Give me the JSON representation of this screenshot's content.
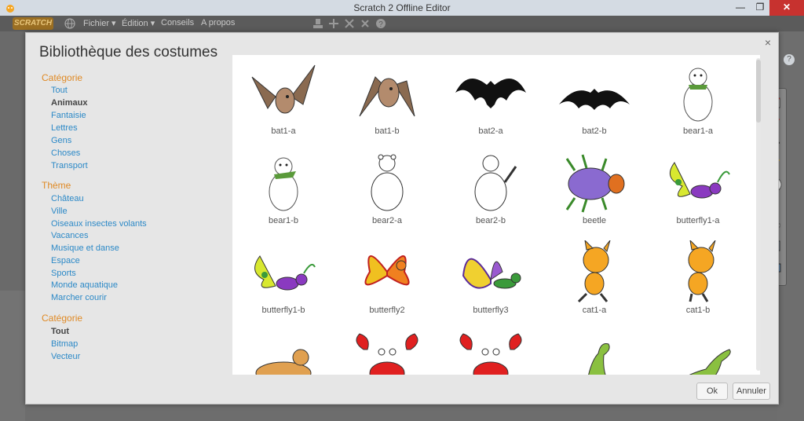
{
  "window": {
    "title": "Scratch 2 Offline Editor"
  },
  "menubar": {
    "logo": "SCRATCH",
    "items": [
      "Fichier ▾",
      "Édition ▾",
      "Conseils",
      "A propos"
    ]
  },
  "dialog": {
    "title": "Bibliothèque des costumes",
    "close": "×",
    "sidebar": {
      "category_heading": "Catégorie",
      "categories": [
        "Tout",
        "Animaux",
        "Fantaisie",
        "Lettres",
        "Gens",
        "Choses",
        "Transport"
      ],
      "selected_category": "Animaux",
      "theme_heading": "Thème",
      "themes": [
        "Château",
        "Ville",
        "Oiseaux insectes volants",
        "Vacances",
        "Musique et danse",
        "Espace",
        "Sports",
        "Monde aquatique",
        "Marcher courir"
      ],
      "type_heading": "Catégorie",
      "types": [
        "Tout",
        "Bitmap",
        "Vecteur"
      ],
      "selected_type": "Tout"
    },
    "costumes": [
      "bat1-a",
      "bat1-b",
      "bat2-a",
      "bat2-b",
      "bear1-a",
      "bear1-b",
      "bear2-a",
      "bear2-b",
      "beetle",
      "butterfly1-a",
      "butterfly1-b",
      "butterfly2",
      "butterfly3",
      "cat1-a",
      "cat1-b",
      "",
      "",
      "",
      "",
      ""
    ],
    "ok_label": "Ok",
    "cancel_label": "Annuler"
  },
  "colors": {
    "accent_heading": "#e08a25",
    "link": "#2c89c7",
    "close_button": "#c7322f"
  }
}
